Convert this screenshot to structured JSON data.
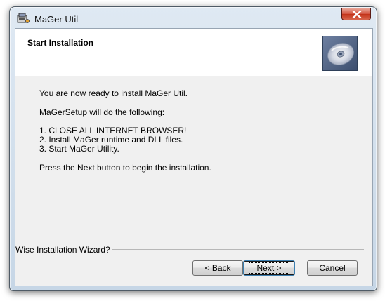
{
  "window": {
    "title": "MaGer Util"
  },
  "header": {
    "title": "Start Installation"
  },
  "body": {
    "lines": [
      "You are now ready to install MaGer Util.",
      "MaGerSetup will do the following:",
      "1. CLOSE ALL INTERNET BROWSER!",
      "2. Install MaGer runtime and DLL files.",
      "3. Start MaGer Utility.",
      "Press the Next button to begin the installation."
    ]
  },
  "footer": {
    "label": "Wise Installation Wizard?",
    "back_label": "< Back",
    "next_label": "Next >",
    "cancel_label": "Cancel"
  },
  "icons": {
    "app": "installer-icon",
    "close": "close-icon",
    "header_art": "cd-disc-icon"
  },
  "colors": {
    "close_button": "#c83c24",
    "title_bar": "#c6d6e6",
    "header_background": "#ffffff",
    "dialog_background": "#f0f0f0"
  }
}
